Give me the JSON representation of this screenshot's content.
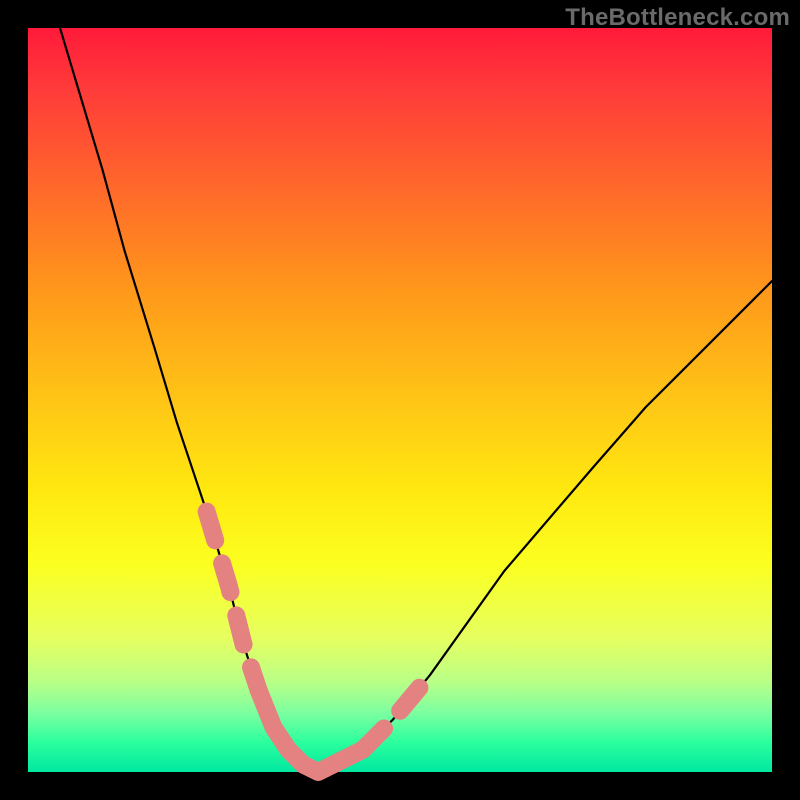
{
  "watermark": "TheBottleneck.com",
  "colors": {
    "frame_bg_top": "#ff1a3a",
    "frame_bg_bottom": "#00e8a0",
    "curve": "#000000",
    "ideal_band": "#e48181",
    "page_bg": "#000000",
    "watermark_text": "#6a6a6a"
  },
  "chart_data": {
    "type": "line",
    "title": "",
    "xlabel": "",
    "ylabel": "",
    "xlim": [
      0,
      100
    ],
    "ylim": [
      0,
      100
    ],
    "grid": false,
    "legend_position": "none",
    "annotations": [
      {
        "text": "TheBottleneck.com",
        "role": "watermark",
        "position": "top-right"
      }
    ],
    "series": [
      {
        "name": "bottleneck-curve",
        "role": "curve",
        "x": [
          4,
          7,
          10,
          13,
          17,
          20,
          24,
          27,
          29,
          31,
          33,
          35,
          37,
          39,
          41,
          45,
          49,
          54,
          59,
          64,
          70,
          76,
          83,
          90,
          97,
          100
        ],
        "values": [
          101,
          91,
          81,
          70,
          57,
          47,
          35,
          25,
          17,
          11,
          6,
          3,
          1,
          0,
          1,
          3,
          7,
          13,
          20,
          27,
          34,
          41,
          49,
          56,
          63,
          66
        ]
      },
      {
        "name": "ideal-range-left",
        "role": "highlight-band",
        "style": "dashed",
        "x": [
          24,
          27,
          29,
          31
        ],
        "values": [
          35,
          25,
          17,
          11
        ]
      },
      {
        "name": "ideal-range-bottom",
        "role": "highlight-band",
        "style": "solid",
        "x": [
          31,
          33,
          35,
          37,
          39,
          41,
          45
        ],
        "values": [
          11,
          6,
          3,
          1,
          0,
          1,
          3
        ]
      },
      {
        "name": "ideal-range-right",
        "role": "highlight-band",
        "style": "dashed",
        "x": [
          45,
          49,
          54
        ],
        "values": [
          3,
          7,
          13
        ]
      }
    ]
  }
}
